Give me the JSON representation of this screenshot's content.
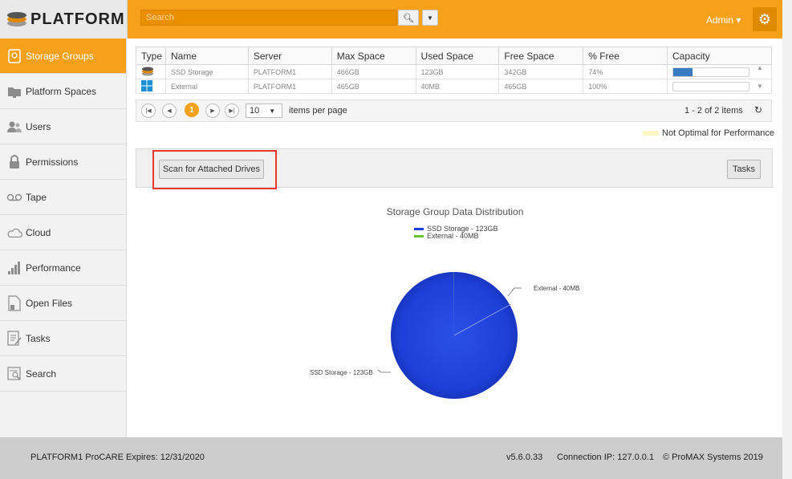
{
  "app": {
    "brand": "PLATFORM"
  },
  "header": {
    "search_placeholder": "Search",
    "user_label": "Admin ▾",
    "accent": "#f7a11a"
  },
  "sidebar": {
    "items": [
      {
        "label": "Storage Groups",
        "icon": "storage-icon",
        "active": true
      },
      {
        "label": "Platform Spaces",
        "icon": "folder-icon",
        "active": false
      },
      {
        "label": "Users",
        "icon": "users-icon",
        "active": false
      },
      {
        "label": "Permissions",
        "icon": "lock-icon",
        "active": false
      },
      {
        "label": "Tape",
        "icon": "tape-icon",
        "active": false
      },
      {
        "label": "Cloud",
        "icon": "cloud-icon",
        "active": false
      },
      {
        "label": "Performance",
        "icon": "bar-chart-icon",
        "active": false
      },
      {
        "label": "Open Files",
        "icon": "open-file-icon",
        "active": false
      },
      {
        "label": "Tasks",
        "icon": "tasks-icon",
        "active": false
      },
      {
        "label": "Search",
        "icon": "search-doc-icon",
        "active": false
      }
    ]
  },
  "table": {
    "columns": [
      "Type",
      "Name",
      "Server",
      "Max Space",
      "Used Space",
      "Free Space",
      "% Free",
      "Capacity"
    ],
    "rows": [
      {
        "type_icon": "ssd-stack-icon",
        "name": "SSD Storage",
        "server": "PLATFORM1",
        "max": "466GB",
        "used": "123GB",
        "free": "342GB",
        "pct_free": "74%",
        "capacity_fraction": 0.26
      },
      {
        "type_icon": "windows-icon",
        "name": "External",
        "server": "PLATFORM1",
        "max": "465GB",
        "used": "40MB",
        "free": "465GB",
        "pct_free": "100%",
        "capacity_fraction": 0.0
      }
    ]
  },
  "pager": {
    "current_page": "1",
    "page_size": "10",
    "per_page_label": "items per page",
    "info": "1 - 2 of 2 items"
  },
  "legend_note": "Not Optimal for Performance",
  "actions": {
    "scan_label": "Scan for Attached Drives",
    "tasks_label": "Tasks"
  },
  "chart_data": {
    "type": "pie",
    "title": "Storage Group Data Distribution",
    "categories": [
      "SSD Storage",
      "External"
    ],
    "values": [
      123000,
      40
    ],
    "units": [
      "GB",
      "MB"
    ],
    "legend": [
      "SSD Storage - 123GB",
      "External - 40MB"
    ],
    "data_labels": [
      "SSD Storage - 123GB",
      "External - 40MB"
    ],
    "colors": [
      "#1e3fd8",
      "#6ac431"
    ],
    "legend_placement": "top-center"
  },
  "footer": {
    "license": "PLATFORM1 ProCARE Expires: 12/31/2020",
    "version": "v5.6.0.33",
    "connection": "Connection IP: 127.0.0.1",
    "copyright": "© ProMAX Systems 2019"
  }
}
